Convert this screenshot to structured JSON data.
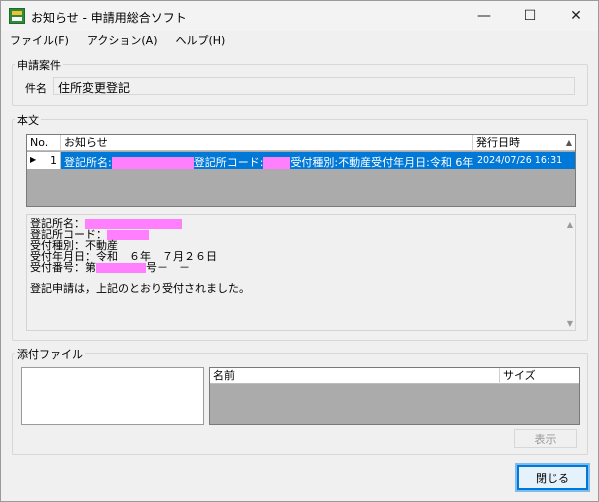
{
  "window": {
    "title": "お知らせ - 申請用総合ソフト",
    "minimize_glyph": "—",
    "maximize_glyph": "☐",
    "close_glyph": "✕"
  },
  "menu": {
    "items": [
      "ファイル(F)",
      "アクション(A)",
      "ヘルプ(H)"
    ]
  },
  "application_group": {
    "title": "申請案件",
    "subject_label": "件名",
    "subject_value": "住所変更登記"
  },
  "main_text_group": {
    "title": "本文",
    "grid": {
      "headers": [
        "No.",
        "お知らせ",
        "発行日時"
      ],
      "row": {
        "no": "1",
        "message_part1": "登記所名:",
        "message_part2": "登記所コード:",
        "message_part3": "受付種別:不動産受付年月日:令和 6年…",
        "date": "2024/07/26 16:31"
      }
    },
    "body": {
      "line1": "登記所名：",
      "line2": "登記所コード：",
      "line3": "受付種別：不動産",
      "line4": "受付年月日：令和　６年　７月２６日",
      "line5a": "受付番号：第",
      "line5b": "号－　－",
      "line6": "登記申請は，上記のとおり受付されました。"
    }
  },
  "attachment_group": {
    "title": "添付ファイル",
    "headers": [
      "名前",
      "サイズ"
    ],
    "show_button": "表示"
  },
  "close_button": "閉じる",
  "colors": {
    "selection": "#0078d7",
    "redaction": "#ff7fff",
    "focus": "#0078d7"
  }
}
